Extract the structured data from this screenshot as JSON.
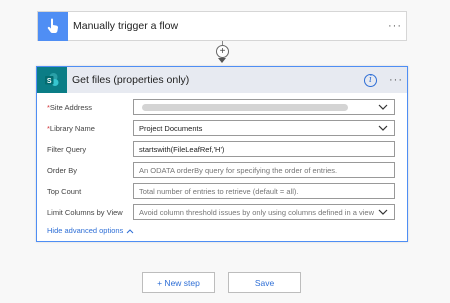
{
  "trigger": {
    "title": "Manually trigger a flow",
    "more": "···"
  },
  "action": {
    "title": "Get files (properties only)",
    "more": "···",
    "info": "i",
    "fields": [
      {
        "label": "Site Address",
        "required": "*",
        "value": "",
        "kind": "dropdown"
      },
      {
        "label": "Library Name",
        "required": "*",
        "value": "Project Documents",
        "kind": "dropdown"
      },
      {
        "label": "Filter Query",
        "value": "startswith(FileLeafRef,'H')",
        "kind": "text"
      },
      {
        "label": "Order By",
        "placeholder": "An ODATA orderBy query for specifying the order of entries.",
        "kind": "text"
      },
      {
        "label": "Top Count",
        "placeholder": "Total number of entries to retrieve (default = all).",
        "kind": "text"
      },
      {
        "label": "Limit Columns by View",
        "placeholder": "Avoid column threshold issues by only using columns defined in a view",
        "kind": "dropdown"
      }
    ],
    "advanced_toggle": "Hide advanced options"
  },
  "buttons": {
    "new_step": "+ New step",
    "save": "Save"
  },
  "colors": {
    "accent": "#4f8ef4",
    "sharepoint": "#0b7d86",
    "link": "#2f6fd6",
    "required": "#d13438"
  },
  "icons": {
    "trigger": "hand-touch-icon",
    "action": "sharepoint-icon"
  }
}
